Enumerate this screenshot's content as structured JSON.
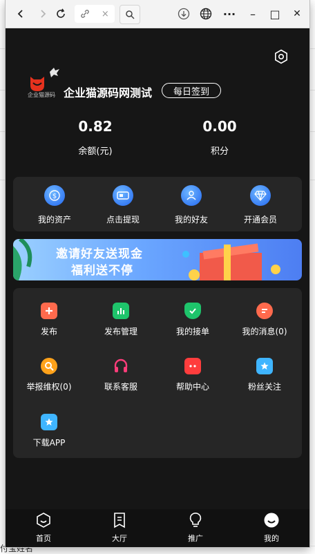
{
  "browser": {
    "back_icon": "‹",
    "forward_icon": "›",
    "close_tab_label": "×",
    "window_minimize": "–",
    "window_maximize": "□",
    "window_close": "✕",
    "more": "···"
  },
  "app": {
    "logo_text": "企业猫源码",
    "brand": "企业猫源码网测试",
    "checkin_label": "每日签到",
    "stats": [
      {
        "value": "0.82",
        "label": "余额(元)"
      },
      {
        "value": "0.00",
        "label": "积分"
      }
    ],
    "quick_actions": [
      {
        "label": "我的资产",
        "icon": "coin-icon"
      },
      {
        "label": "点击提现",
        "icon": "card-icon"
      },
      {
        "label": "我的好友",
        "icon": "friends-icon"
      },
      {
        "label": "开通会员",
        "icon": "diamond-icon"
      }
    ],
    "banner": {
      "line1": "邀请好友送现金",
      "line2": "福利送不停"
    },
    "grid": [
      {
        "label": "发布",
        "color": "#ff6a4d",
        "icon": "plus-icon"
      },
      {
        "label": "发布管理",
        "color": "#1ec46b",
        "icon": "bar-chart-icon"
      },
      {
        "label": "我的接单",
        "color": "#1ec46b",
        "icon": "shield-check-icon"
      },
      {
        "label": "我的消息(0)",
        "color": "#ff6a4d",
        "icon": "message-icon"
      },
      {
        "label": "举报维权(0)",
        "color": "#ffa21a",
        "icon": "search-report-icon"
      },
      {
        "label": "联系客服",
        "color": "#ff3d7a",
        "icon": "headset-icon"
      },
      {
        "label": "帮助中心",
        "color": "#ff3d3d",
        "icon": "help-icon"
      },
      {
        "label": "粉丝关注",
        "color": "#3fb5ff",
        "icon": "star-icon"
      },
      {
        "label": "下载APP",
        "color": "#3fb5ff",
        "icon": "download-star-icon"
      }
    ],
    "tabs": [
      {
        "label": "首页",
        "icon": "home-icon"
      },
      {
        "label": "大厅",
        "icon": "bookmark-icon"
      },
      {
        "label": "推广",
        "icon": "bulb-icon"
      },
      {
        "label": "我的",
        "icon": "user-icon"
      }
    ]
  },
  "background_page": {
    "bottom_text": "付宝姓名"
  }
}
